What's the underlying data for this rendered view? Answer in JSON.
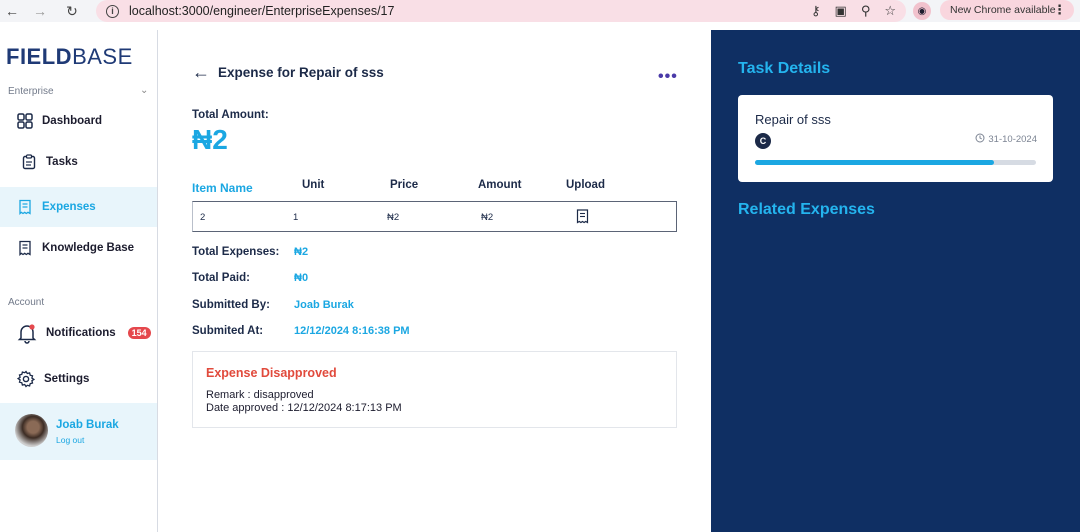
{
  "browser": {
    "url": "localhost:3000/engineer/EnterpriseExpenses/17",
    "update_label": "New Chrome available"
  },
  "sidebar": {
    "logo_left": "FIELD",
    "logo_right": "BASE",
    "enterprise_label": "Enterprise",
    "account_label": "Account",
    "items": [
      {
        "label": "Dashboard"
      },
      {
        "label": "Tasks"
      },
      {
        "label": "Expenses"
      },
      {
        "label": "Knowledge Base"
      },
      {
        "label": "Notifications",
        "badge": "154"
      },
      {
        "label": "Settings"
      }
    ],
    "active_item": "Expenses",
    "user": {
      "name": "Joab Burak",
      "logout": "Log out"
    }
  },
  "main": {
    "title": "Expense for Repair of sss",
    "total_amount_label": "Total Amount:",
    "total_amount_value": "₦2",
    "table": {
      "headers": [
        "Item Name",
        "Unit",
        "Price",
        "Amount",
        "Upload"
      ],
      "rows": [
        {
          "item_name": "2",
          "unit": "1",
          "price": "₦2",
          "amount": "₦2"
        }
      ]
    },
    "summary": [
      {
        "label": "Total Expenses:",
        "value": "₦2"
      },
      {
        "label": "Total Paid:",
        "value": "₦0"
      },
      {
        "label": "Submitted By:",
        "value": "Joab Burak"
      },
      {
        "label": "Submited At:",
        "value": "12/12/2024 8:16:38 PM"
      }
    ],
    "status": {
      "title": "Expense Disapproved",
      "remark": "Remark : disapproved",
      "date_approved": "Date approved : 12/12/2024 8:17:13 PM"
    }
  },
  "right_panel": {
    "task_details_heading": "Task Details",
    "task": {
      "name": "Repair of sss",
      "badge": "C",
      "date": "31-10-2024",
      "progress": 0.85
    },
    "related_heading": "Related Expenses"
  },
  "colors": {
    "accent": "#1ba7e2",
    "panel": "#0f2f63",
    "danger": "#e14a3c",
    "badge": "#e5484d"
  }
}
